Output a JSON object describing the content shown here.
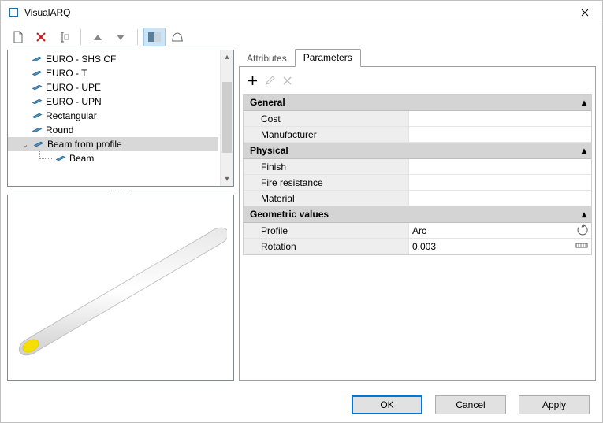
{
  "window": {
    "title": "VisualARQ"
  },
  "tree": {
    "items": [
      {
        "label": "EURO - SHS CF",
        "depth": 1
      },
      {
        "label": "EURO - T",
        "depth": 1
      },
      {
        "label": "EURO - UPE",
        "depth": 1
      },
      {
        "label": "EURO - UPN",
        "depth": 1
      },
      {
        "label": "Rectangular",
        "depth": 1
      },
      {
        "label": "Round",
        "depth": 1
      },
      {
        "label": "Beam from profile",
        "depth": 0,
        "selected": true,
        "expanded": true
      },
      {
        "label": "Beam",
        "depth": 2,
        "child": true
      }
    ]
  },
  "tabs": {
    "attributes": "Attributes",
    "parameters": "Parameters",
    "active": "parameters"
  },
  "param_toolbar": {
    "add_icon": "add-icon",
    "edit_icon": "edit-icon",
    "delete_icon": "delete-icon"
  },
  "parameters": {
    "groups": [
      {
        "name": "General",
        "rows": [
          {
            "name": "Cost",
            "value": ""
          },
          {
            "name": "Manufacturer",
            "value": ""
          }
        ]
      },
      {
        "name": "Physical",
        "rows": [
          {
            "name": "Finish",
            "value": ""
          },
          {
            "name": "Fire resistance",
            "value": ""
          },
          {
            "name": "Material",
            "value": ""
          }
        ]
      },
      {
        "name": "Geometric values",
        "rows": [
          {
            "name": "Profile",
            "value": "Arc",
            "icon": "profile-icon"
          },
          {
            "name": "Rotation",
            "value": "0.003",
            "icon": "length-icon"
          }
        ]
      }
    ]
  },
  "buttons": {
    "ok": "OK",
    "cancel": "Cancel",
    "apply": "Apply"
  }
}
